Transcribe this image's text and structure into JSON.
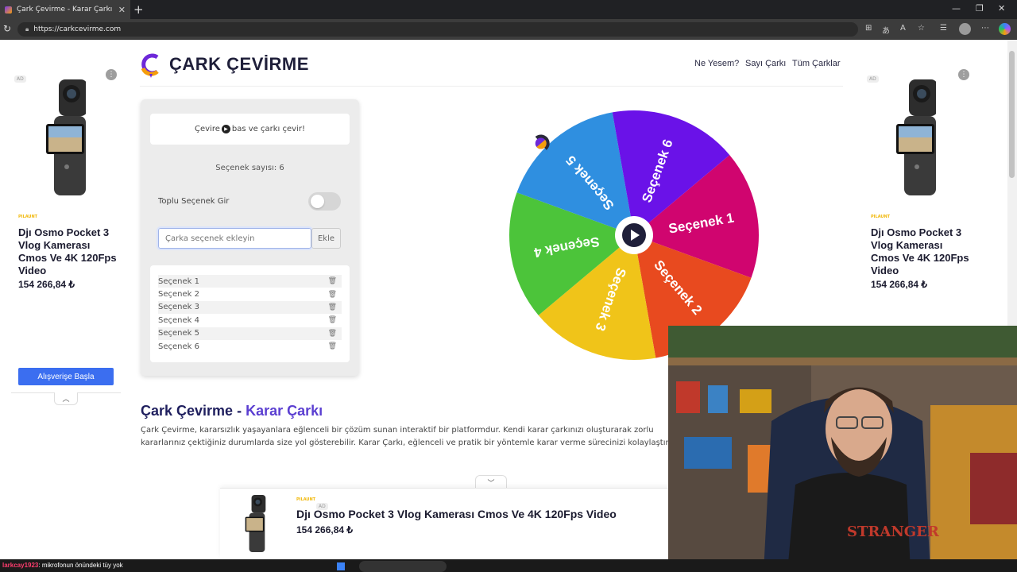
{
  "browser": {
    "tab_title": "Çark Çevirme - Karar Çarkı",
    "url": "https://carkcevirme.com"
  },
  "header": {
    "logo_text": "ÇARK ÇEVİRME",
    "nav": [
      "Ne Yesem?",
      "Sayı Çarkı",
      "Tüm Çarklar"
    ]
  },
  "panel": {
    "instruction_before": "Çevire",
    "instruction_after": "bas ve çarkı çevir!",
    "count_label": "Seçenek sayısı: 6",
    "bulk_label": "Toplu Seçenek Gir",
    "bulk_enabled": false,
    "input_placeholder": "Çarka seçenek ekleyin",
    "add_label": "Ekle",
    "options": [
      "Seçenek 1",
      "Seçenek 2",
      "Seçenek 3",
      "Seçenek 4",
      "Seçenek 5",
      "Seçenek 6"
    ]
  },
  "wheel": {
    "slices": [
      {
        "label": "Seçenek 1",
        "color": "#d0056f"
      },
      {
        "label": "Seçenek 2",
        "color": "#e84a1f"
      },
      {
        "label": "Seçenek 3",
        "color": "#f0c419"
      },
      {
        "label": "Seçenek 4",
        "color": "#4cc43a"
      },
      {
        "label": "Seçenek 5",
        "color": "#2f8fe0"
      },
      {
        "label": "Seçenek 6",
        "color": "#6a12e8"
      }
    ]
  },
  "content": {
    "title_part1": "Çark Çevirme - ",
    "title_part2": "Karar Çarkı",
    "text": "Çark Çevirme, kararsızlık yaşayanlara eğlenceli bir çözüm sunan interaktif bir platformdur. Kendi karar çarkınızı oluşturarak zorlu kararlarınız çektiğiniz durumlarda size yol gösterebilir. Karar Çarkı, eğlenceli ve pratik bir yöntemle karar verme sürecinizi kolaylaştırır."
  },
  "ads": {
    "tag": "AD",
    "brand": "PILAUNT",
    "side_title": "Djı Osmo Pocket 3 Vlog Kamerası Cmos Ve 4K 120Fps Video",
    "side_price": "154 266,84 ₺",
    "shop_button": "Alışverişe Başla",
    "bottom_title": "Djı Osmo Pocket 3 Vlog Kamerası Cmos Ve 4K 120Fps Video",
    "bottom_price": "154 266,84 ₺"
  },
  "chat": {
    "user": "larkcay1923",
    "message": ": mikrofonun önündeki tüy yok"
  }
}
